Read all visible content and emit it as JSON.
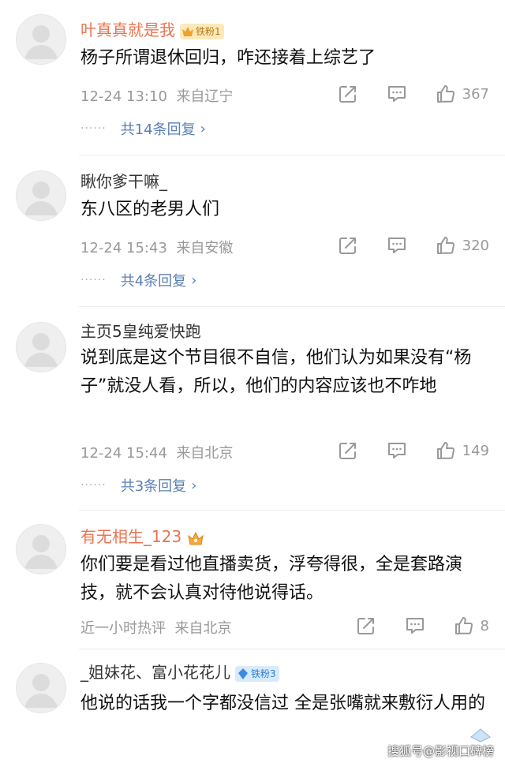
{
  "comments": [
    {
      "username": "叶真真就是我",
      "badge_label": "铁粉1",
      "text": "杨子所谓退休回归，咋还接着上综艺了",
      "time": "12-24 13:10",
      "location": "来自辽宁",
      "likes": "367",
      "replies": "共14条回复"
    },
    {
      "username": "瞅你爹干嘛_",
      "text": "东八区的老男人们",
      "time": "12-24 15:43",
      "location": "来自安徽",
      "likes": "320",
      "replies": "共4条回复"
    },
    {
      "username": "主页5皇纯爱快跑",
      "text": "说到底是这个节目很不自信，他们认为如果没有“杨子”就没人看，所以，他们的内容应该也不咋地",
      "time": "12-24 15:44",
      "location": "来自北京",
      "likes": "149",
      "replies": "共3条回复"
    },
    {
      "username": "有无相生_123",
      "text": "你们要是看过他直播卖货，浮夸得很，全是套路演技，就不会认真对待他说得话。",
      "time": "近一小时热评",
      "location": "来自北京",
      "likes": "8"
    },
    {
      "username": "_姐妹花、富小花花儿",
      "badge_label": "铁粉3",
      "text": "他说的话我一个字都没信过 全是张嘴就来敷衍人用的"
    }
  ],
  "watermark": "搜狐号@影视口碑榜",
  "colors": {
    "vip_name": "#eb7350",
    "link": "#5b7fb4",
    "meta": "#999999"
  },
  "icons": [
    "share-icon",
    "comment-icon",
    "like-icon",
    "crown-icon",
    "diamond-icon"
  ]
}
